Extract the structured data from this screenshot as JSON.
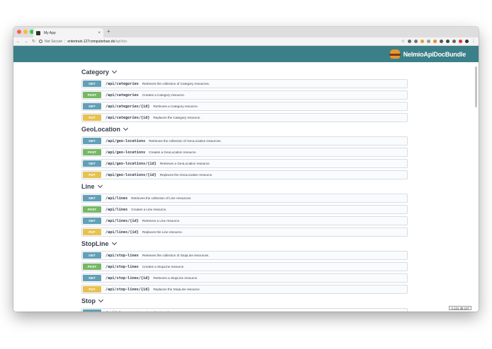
{
  "browser": {
    "tab_title": "My App",
    "tab_close": "×",
    "new_tab": "+",
    "not_secure": "Not Secure",
    "url_host": "entertrain.127computerban.de",
    "url_path": "/api/doc"
  },
  "header": {
    "brand": "NelmioApiDocBundle"
  },
  "sections": [
    {
      "title": "Category",
      "ops": [
        {
          "method": "GET",
          "path": "/api/categories",
          "summary": "Retrieves the collection of Category resources."
        },
        {
          "method": "POST",
          "path": "/api/categories",
          "summary": "Creates a Category resource."
        },
        {
          "method": "GET",
          "path": "/api/categories/{id}",
          "summary": "Retrieves a Category resource."
        },
        {
          "method": "PUT",
          "path": "/api/categories/{id}",
          "summary": "Replaces the Category resource."
        }
      ]
    },
    {
      "title": "GeoLocation",
      "ops": [
        {
          "method": "GET",
          "path": "/api/geo-locations",
          "summary": "Retrieves the collection of GeoLocation resources."
        },
        {
          "method": "POST",
          "path": "/api/geo-locations",
          "summary": "Creates a GeoLocation resource."
        },
        {
          "method": "GET",
          "path": "/api/geo-locations/{id}",
          "summary": "Retrieves a GeoLocation resource."
        },
        {
          "method": "PUT",
          "path": "/api/geo-locations/{id}",
          "summary": "Replaces the GeoLocation resource."
        }
      ]
    },
    {
      "title": "Line",
      "ops": [
        {
          "method": "GET",
          "path": "/api/lines",
          "summary": "Retrieves the collection of Line resources."
        },
        {
          "method": "POST",
          "path": "/api/lines",
          "summary": "Creates a Line resource."
        },
        {
          "method": "GET",
          "path": "/api/lines/{id}",
          "summary": "Retrieves a Line resource."
        },
        {
          "method": "PUT",
          "path": "/api/lines/{id}",
          "summary": "Replaces the Line resource."
        }
      ]
    },
    {
      "title": "StopLine",
      "ops": [
        {
          "method": "GET",
          "path": "/api/stop-lines",
          "summary": "Retrieves the collection of StopLine resources."
        },
        {
          "method": "POST",
          "path": "/api/stop-lines",
          "summary": "Creates a StopLine resource."
        },
        {
          "method": "GET",
          "path": "/api/stop-lines/{id}",
          "summary": "Retrieves a StopLine resource."
        },
        {
          "method": "PUT",
          "path": "/api/stop-lines/{id}",
          "summary": "Replaces the StopLine resource."
        }
      ]
    },
    {
      "title": "Stop",
      "ops": [
        {
          "method": "GET",
          "path": "/api/stops",
          "summary": "Retrieves the collection of Stop resources."
        }
      ]
    }
  ],
  "footer": {
    "version": "3.121.38.107"
  },
  "colors": {
    "header_bg": "#3b8088",
    "get": "#61a0b7",
    "post": "#77b865",
    "put": "#e8c24f"
  }
}
